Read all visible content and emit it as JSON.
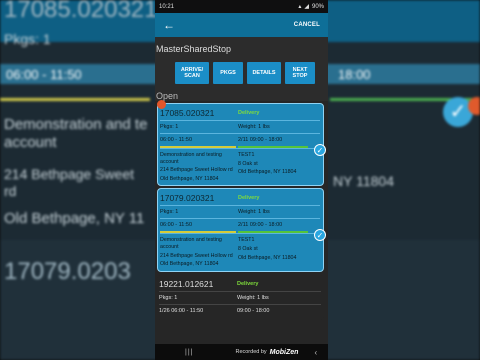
{
  "status": {
    "time": "10:21",
    "battery": "90%"
  },
  "appbar": {
    "back_icon": "arrow-left-icon",
    "cancel_label": "CANCEL"
  },
  "stop_name": "MasterSharedStop",
  "buttons": {
    "arrive": "ARRIVE/ SCAN",
    "pkgs": "PKGS",
    "details": "DETAILS",
    "next": "NEXT STOP"
  },
  "section_label": "Open",
  "background": {
    "id1": "17085.020321",
    "pkgs": "Pkgs: 1",
    "time": "06:00 - 11:50",
    "time_right": "18:00",
    "company": "Demonstration and testing account",
    "company_short": "Demonstration and te",
    "account": "account",
    "street": "214 Bethpage Sweet",
    "street2": "rd",
    "city": "Old Bethpage, NY 11",
    "city_right": "NY 11804",
    "id2": "17079.0203"
  },
  "cards": [
    {
      "id": "17085.020321",
      "type": "Delivery",
      "pkgs": "Pkgs: 1",
      "weight": "Weight: 1 lbs",
      "time": "06:00 - 11:50",
      "date_window": "2/11 09:00 - 18:00",
      "company": "Demonstration and testing account",
      "street": "214 Bethpage Sweet Hollow rd",
      "city": "Old Bethpage, NY 11804",
      "contact": "TEST1",
      "contact_street": "8 Oak st",
      "contact_city": "Old Bethpage, NY 11804"
    },
    {
      "id": "17079.020321",
      "type": "Delivery",
      "pkgs": "Pkgs: 1",
      "weight": "Weight: 1 lbs",
      "time": "06:00 - 11:50",
      "date_window": "2/11 09:00 - 18:00",
      "company": "Demonstration and testing account",
      "street": "214 Bethpage Sweet Hollow rd",
      "city": "Old Bethpage, NY 11804",
      "contact": "TEST1",
      "contact_street": "8 Oak st",
      "contact_city": "Old Bethpage, NY 11804"
    },
    {
      "id": "19221.012621",
      "type": "Delivery",
      "pkgs": "Pkgs: 1",
      "weight": "Weight: 1 lbs",
      "time": "1/26 06:00 - 11:50",
      "date_window": "09:00 - 18:00"
    }
  ],
  "navbar": {
    "recorded": "Recorded by",
    "brand": "MobiZen"
  },
  "colors": {
    "accent": "#0e6f98",
    "card": "#1e88b8",
    "delivery": "#7fdc3b"
  }
}
